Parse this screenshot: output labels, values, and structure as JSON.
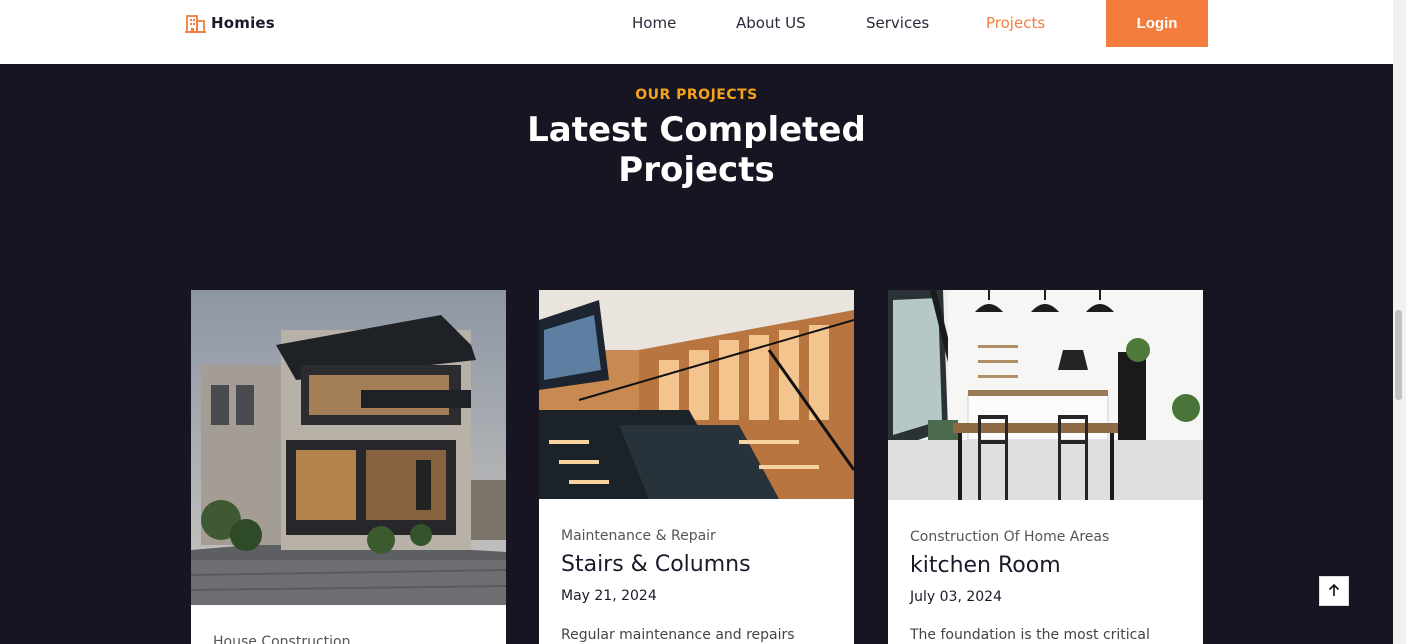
{
  "brand": {
    "name": "Homies",
    "icon": "building-icon",
    "color": "#f47c3c"
  },
  "nav": {
    "items": [
      {
        "label": "Home",
        "active": false
      },
      {
        "label": "About US",
        "active": false
      },
      {
        "label": "Services",
        "active": false
      },
      {
        "label": "Projects",
        "active": true
      }
    ],
    "login_label": "Login"
  },
  "section": {
    "eyebrow": "OUR PROJECTS",
    "heading_line1": "Latest Completed",
    "heading_line2": "Projects"
  },
  "projects": [
    {
      "category": "House Construction",
      "title": "",
      "date": "",
      "description": ""
    },
    {
      "category": "Maintenance & Repair",
      "title": "Stairs & Columns",
      "date": "May 21, 2024",
      "description": "Regular maintenance and repairs"
    },
    {
      "category": "Construction Of Home Areas",
      "title": "kitchen Room",
      "date": "July 03, 2024",
      "description": "The foundation is the most critical"
    }
  ],
  "back_to_top_icon": "arrow-up-icon",
  "colors": {
    "accent": "#f47c3c",
    "eyebrow": "#f4a31a",
    "background": "#181523"
  }
}
